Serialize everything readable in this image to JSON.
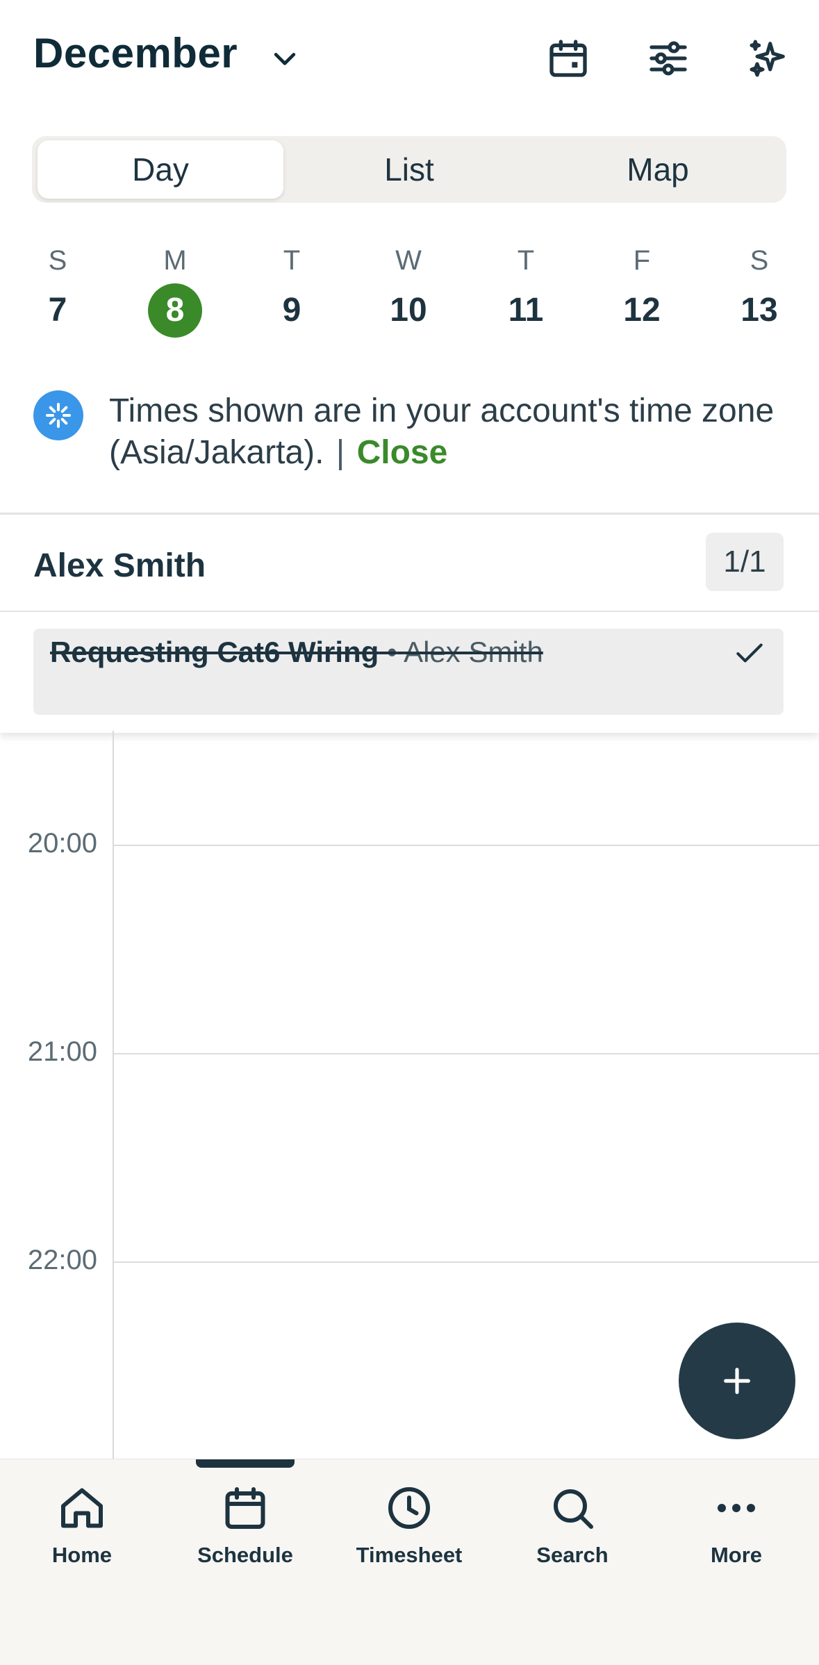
{
  "header": {
    "month": "December",
    "icons": [
      "calendar-icon",
      "filter-sliders-icon",
      "sparkles-icon"
    ]
  },
  "view_tabs": [
    {
      "label": "Day",
      "active": true
    },
    {
      "label": "List",
      "active": false
    },
    {
      "label": "Map",
      "active": false
    }
  ],
  "week": [
    {
      "letter": "S",
      "num": "7"
    },
    {
      "letter": "M",
      "num": "8",
      "selected": true
    },
    {
      "letter": "T",
      "num": "9"
    },
    {
      "letter": "W",
      "num": "10"
    },
    {
      "letter": "T",
      "num": "11"
    },
    {
      "letter": "F",
      "num": "12"
    },
    {
      "letter": "S",
      "num": "13"
    }
  ],
  "banner": {
    "text": "Times shown are in your account's time zone (Asia/Jakarta).",
    "separator": "|",
    "close_label": "Close"
  },
  "technician": {
    "name": "Alex Smith",
    "count": "1/1",
    "job": {
      "title": "Requesting Cat6 Wiring",
      "bullet": "•",
      "person": "Alex Smith",
      "completed": true
    }
  },
  "timeline": {
    "hours": [
      "20:00",
      "21:00",
      "22:00"
    ]
  },
  "nav": {
    "items": [
      {
        "label": "Home",
        "icon": "home-icon"
      },
      {
        "label": "Schedule",
        "icon": "calendar-icon",
        "active": true
      },
      {
        "label": "Timesheet",
        "icon": "clock-icon"
      },
      {
        "label": "Search",
        "icon": "search-icon"
      },
      {
        "label": "More",
        "icon": "more-dots-icon"
      }
    ]
  },
  "colors": {
    "accent_green": "#3a8a2a",
    "dark_navy": "#1d3340",
    "info_blue": "#3a96e8",
    "fab": "#243a47"
  }
}
